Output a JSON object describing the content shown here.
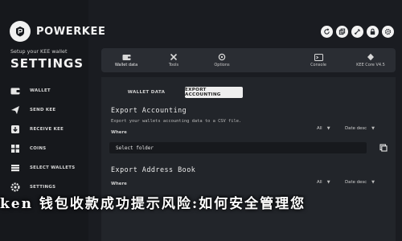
{
  "brand": {
    "name": "POWERKEE",
    "setup_text": "Setup your KEE wallet",
    "section_title": "SETTINGS"
  },
  "sidebar": {
    "items": [
      {
        "label": "WALLET",
        "icon": "wallet-icon"
      },
      {
        "label": "SEND KEE",
        "icon": "send-icon"
      },
      {
        "label": "RECEIVE KEE",
        "icon": "receive-icon"
      },
      {
        "label": "COINS",
        "icon": "coins-icon"
      },
      {
        "label": "SELECT WALLETS",
        "icon": "wallets-icon"
      },
      {
        "label": "SETTINGS",
        "icon": "settings-icon",
        "active": true
      }
    ]
  },
  "top_icons": [
    "refresh-icon",
    "copy-icon",
    "usb-icon",
    "lock-icon",
    "gear-icon"
  ],
  "device_tabs": [
    {
      "label": "Wallet data",
      "icon": "wallet-data-icon",
      "active": true
    },
    {
      "label": "Tools",
      "icon": "tools-icon"
    },
    {
      "label": "Options",
      "icon": "options-icon"
    },
    {
      "label": "Console",
      "icon": "console-icon"
    },
    {
      "label": "KEE Core V4.5",
      "icon": "core-icon"
    }
  ],
  "sub_tabs": [
    {
      "label": "WALLET DATA"
    },
    {
      "label": "EXPORT ACCOUNTING",
      "active": true
    }
  ],
  "export_accounting": {
    "title": "Export Accounting",
    "subtitle": "Export your wallets accounting data to a CSV file.",
    "where_label": "Where",
    "filter_value": "All",
    "sort_value": "Date desc",
    "path_value": "Select folder"
  },
  "export_address_book": {
    "title": "Export Address Book",
    "where_label": "Where",
    "filter_value": "All",
    "sort_value": "Date desc"
  },
  "banner": {
    "text": "ken 钱包收款成功提示风险:如何安全管理您"
  },
  "colors": {
    "bg": "#1a1c21",
    "panel": "#22252a",
    "tabbar": "#2a2d33",
    "active_tab": "#eeeeee"
  }
}
